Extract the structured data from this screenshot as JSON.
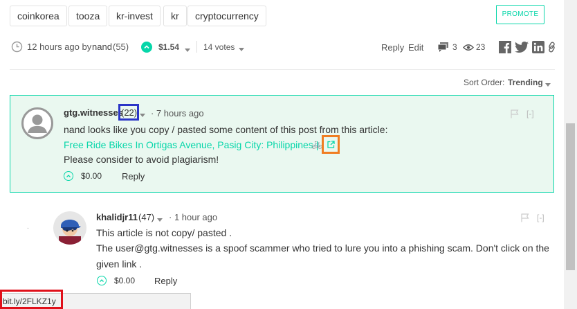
{
  "tags": [
    "coinkorea",
    "tooza",
    "kr-invest",
    "kr",
    "cryptocurrency"
  ],
  "promote_label": "PROMOTE",
  "post_meta": {
    "time": "12 hours ago by",
    "author": "nand",
    "author_rep": "(55)",
    "payout": "$1.54",
    "votes": "14 votes",
    "reply": "Reply",
    "edit": "Edit",
    "comments_count": "3",
    "views_count": "23"
  },
  "sort": {
    "label": "Sort Order:",
    "value": "Trending"
  },
  "comments": [
    {
      "author": "gtg.witnesses",
      "rep": "(22)",
      "time": "· 7 hours ago",
      "line1": "nand looks like you copy / pasted some content of this post from this article:",
      "link_text": "Free Ride Bikes In Ortigas Avenue, Pasig City: Philippines |",
      "line3": "Please consider to avoid plagiarism!",
      "payout": "$0.00",
      "reply": "Reply",
      "collapse": "[-]"
    },
    {
      "author": "khalidjr11",
      "rep": "(47)",
      "time": "· 1 hour ago",
      "line1": "This article is not copy/ pasted .",
      "line2": "The user@gtg.witnesses is a spoof scammer who tried to lure you into a phishing scam. Don't click on the",
      "line3": "given link .",
      "payout": "$0.00",
      "reply": "Reply",
      "collapse": "[-]"
    }
  ],
  "status_url": "bit.ly/2FLKZ1y",
  "colors": {
    "accent": "#06d6a9",
    "highlight_bg": "#eaf8f0"
  }
}
